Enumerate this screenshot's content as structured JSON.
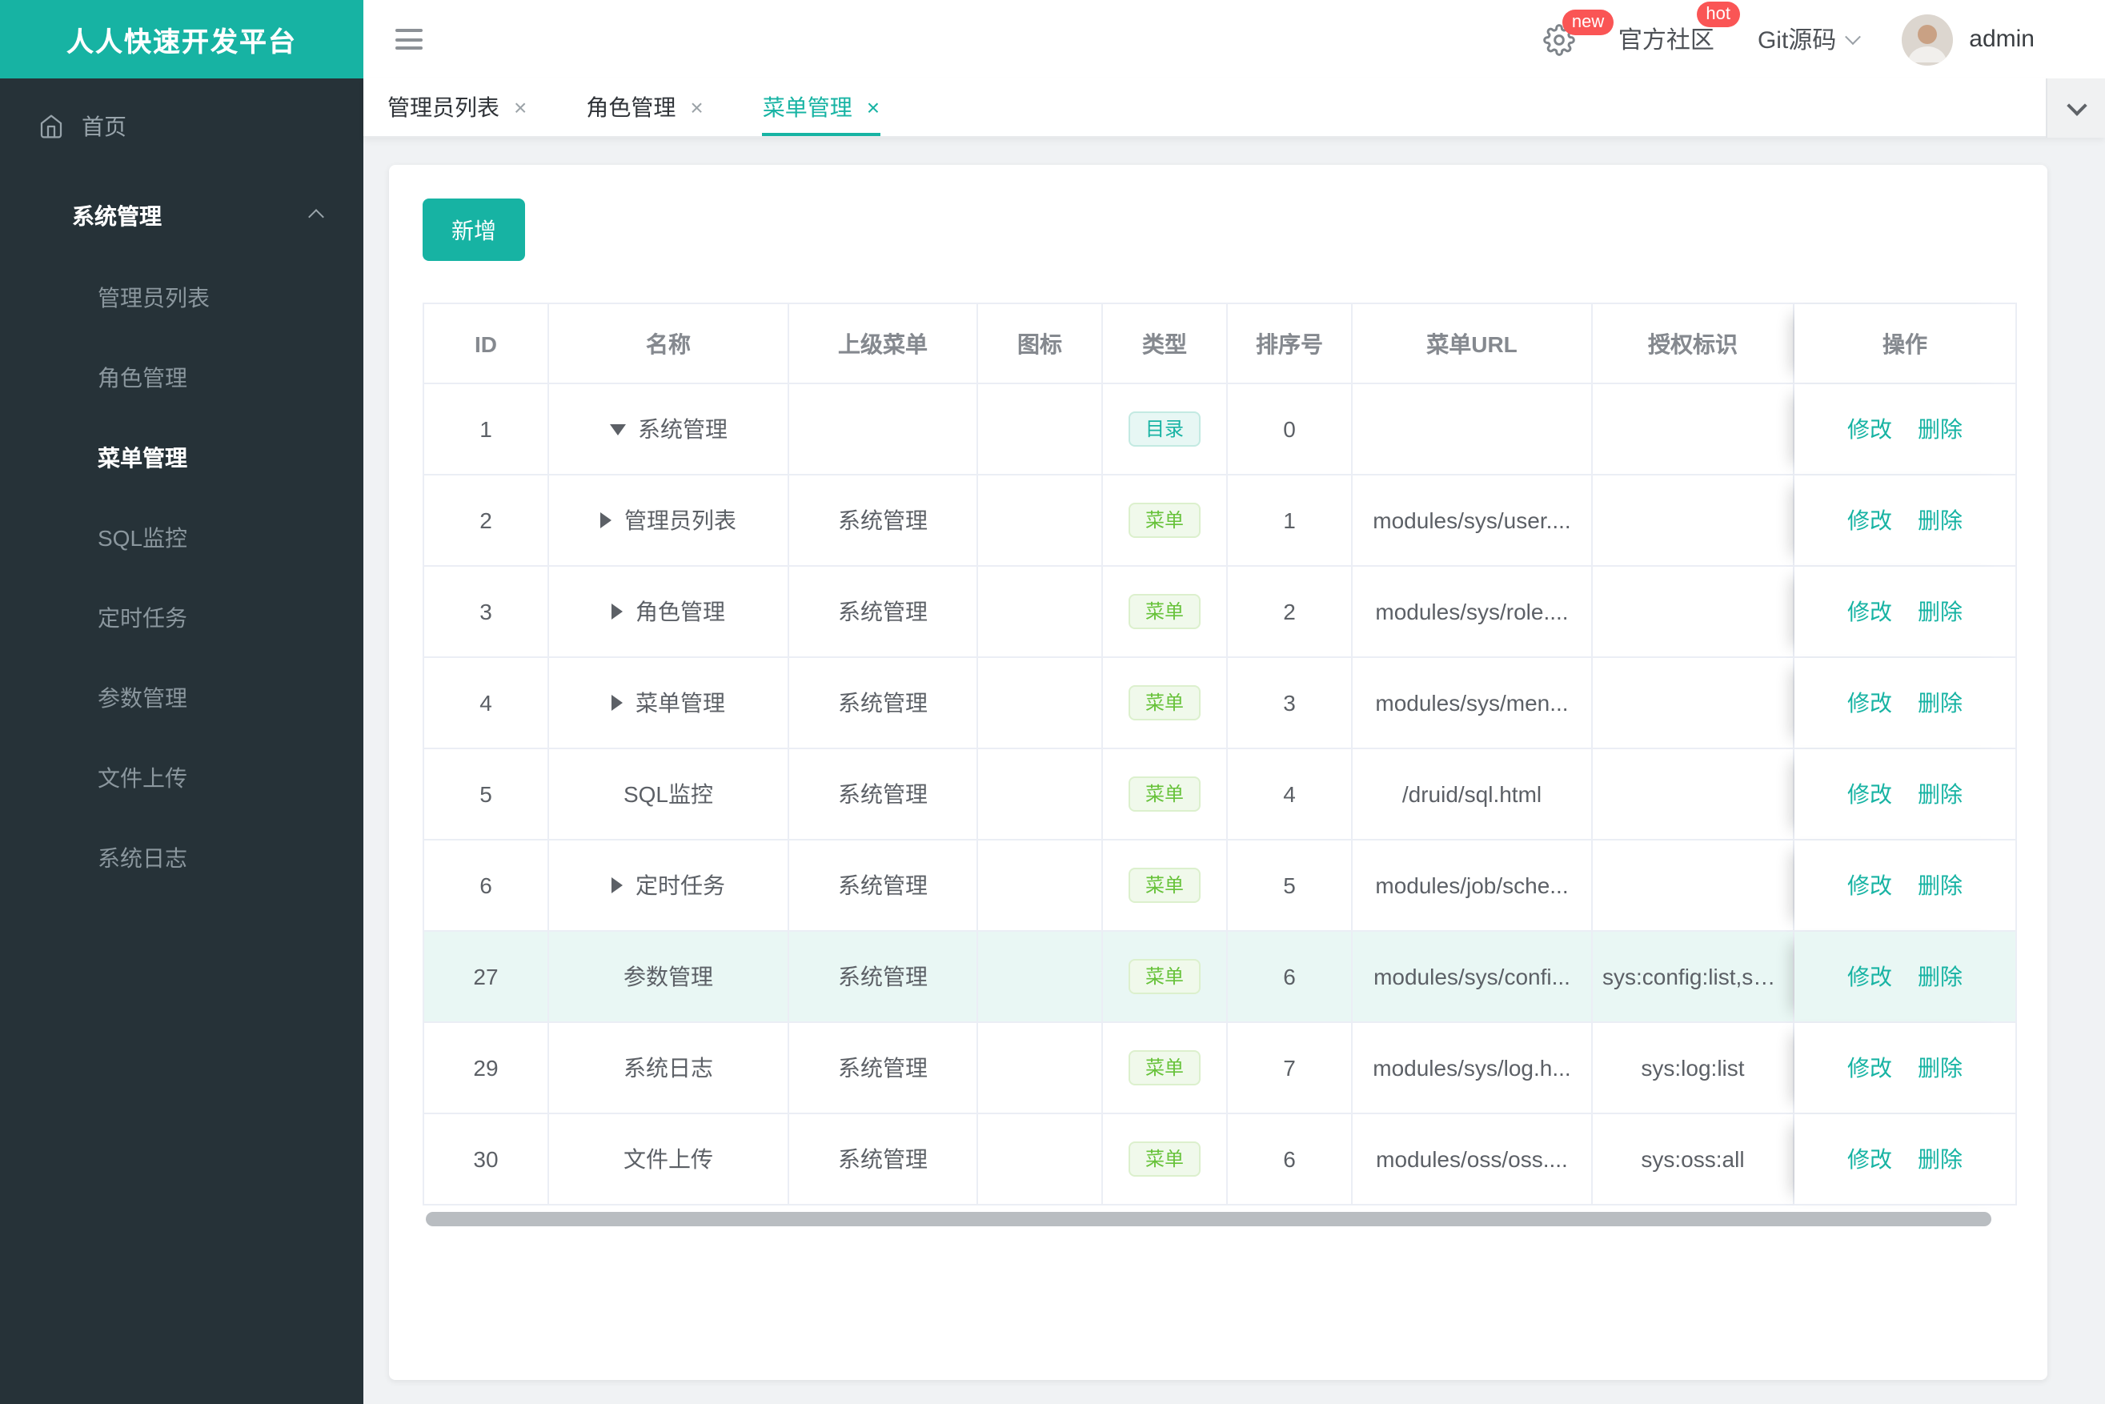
{
  "colors": {
    "accent": "#17b3a3",
    "sidebar_bg": "#263238",
    "badge_red": "#fa5555",
    "tag_green": "#67c23a",
    "row_highlight": "#e9f7f4"
  },
  "brand": {
    "title": "人人快速开发平台"
  },
  "header": {
    "gear_badge": "new",
    "community_label": "官方社区",
    "community_badge": "hot",
    "git_label": "Git源码",
    "username": "admin"
  },
  "sidebar": {
    "home_label": "首页",
    "group": {
      "label": "系统管理",
      "expanded": true,
      "children": [
        {
          "label": "管理员列表",
          "active": false
        },
        {
          "label": "角色管理",
          "active": false
        },
        {
          "label": "菜单管理",
          "active": true
        },
        {
          "label": "SQL监控",
          "active": false
        },
        {
          "label": "定时任务",
          "active": false
        },
        {
          "label": "参数管理",
          "active": false
        },
        {
          "label": "文件上传",
          "active": false
        },
        {
          "label": "系统日志",
          "active": false
        }
      ]
    }
  },
  "tabs": [
    {
      "label": "管理员列表",
      "active": false
    },
    {
      "label": "角色管理",
      "active": false
    },
    {
      "label": "菜单管理",
      "active": true
    }
  ],
  "toolbar": {
    "add_label": "新增"
  },
  "table": {
    "columns": [
      "ID",
      "名称",
      "上级菜单",
      "图标",
      "类型",
      "排序号",
      "菜单URL",
      "授权标识",
      "操作"
    ],
    "actions": {
      "edit": "修改",
      "delete": "删除"
    },
    "rows": [
      {
        "id": 1,
        "arrow": "down",
        "name": "系统管理",
        "parent": "",
        "icon": "",
        "type": "目录",
        "type_style": "catalog",
        "sort": 0,
        "url": "",
        "auth": "",
        "highlight": false
      },
      {
        "id": 2,
        "arrow": "right",
        "name": "管理员列表",
        "parent": "系统管理",
        "icon": "",
        "type": "菜单",
        "type_style": "menu",
        "sort": 1,
        "url": "modules/sys/user....",
        "auth": "",
        "highlight": false
      },
      {
        "id": 3,
        "arrow": "right",
        "name": "角色管理",
        "parent": "系统管理",
        "icon": "",
        "type": "菜单",
        "type_style": "menu",
        "sort": 2,
        "url": "modules/sys/role....",
        "auth": "",
        "highlight": false
      },
      {
        "id": 4,
        "arrow": "right",
        "name": "菜单管理",
        "parent": "系统管理",
        "icon": "",
        "type": "菜单",
        "type_style": "menu",
        "sort": 3,
        "url": "modules/sys/men...",
        "auth": "",
        "highlight": false
      },
      {
        "id": 5,
        "arrow": "",
        "name": "SQL监控",
        "parent": "系统管理",
        "icon": "",
        "type": "菜单",
        "type_style": "menu",
        "sort": 4,
        "url": "/druid/sql.html",
        "auth": "",
        "highlight": false
      },
      {
        "id": 6,
        "arrow": "right",
        "name": "定时任务",
        "parent": "系统管理",
        "icon": "",
        "type": "菜单",
        "type_style": "menu",
        "sort": 5,
        "url": "modules/job/sche...",
        "auth": "",
        "highlight": false
      },
      {
        "id": 27,
        "arrow": "",
        "name": "参数管理",
        "parent": "系统管理",
        "icon": "",
        "type": "菜单",
        "type_style": "menu",
        "sort": 6,
        "url": "modules/sys/confi...",
        "auth": "sys:config:list,sys:...",
        "highlight": true
      },
      {
        "id": 29,
        "arrow": "",
        "name": "系统日志",
        "parent": "系统管理",
        "icon": "",
        "type": "菜单",
        "type_style": "menu",
        "sort": 7,
        "url": "modules/sys/log.h...",
        "auth": "sys:log:list",
        "highlight": false
      },
      {
        "id": 30,
        "arrow": "",
        "name": "文件上传",
        "parent": "系统管理",
        "icon": "",
        "type": "菜单",
        "type_style": "menu",
        "sort": 6,
        "url": "modules/oss/oss....",
        "auth": "sys:oss:all",
        "highlight": false
      }
    ]
  }
}
